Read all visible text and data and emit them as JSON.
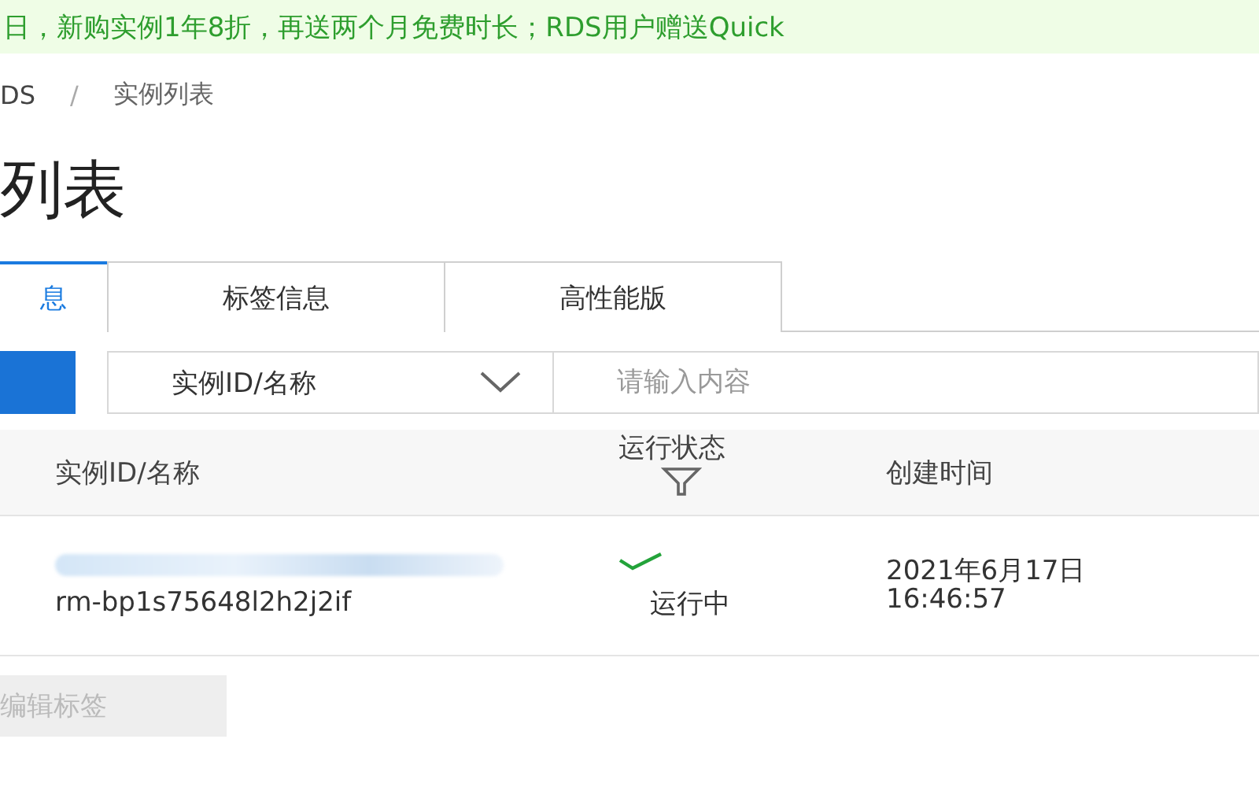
{
  "banner": {
    "text": "日，新购实例1年8折，再送两个月免费时长；RDS用户赠送Quick"
  },
  "breadcrumb": {
    "items": [
      "DS",
      "实例列表"
    ],
    "separator": "/"
  },
  "page_title": "列表",
  "tabs": [
    {
      "label": "息",
      "selected": true
    },
    {
      "label": "标签信息",
      "selected": false
    },
    {
      "label": "高性能版",
      "selected": false
    }
  ],
  "search": {
    "select": "实例ID/名称",
    "placeholder": "请输入内容"
  },
  "table": {
    "columns": [
      "实例ID/名称",
      "运行状态",
      "创建时间"
    ],
    "rows": [
      {
        "id": "rm-bp1s75648l2h2j2if",
        "status": "运行中",
        "running": true,
        "created": "2021年6月17日\n16:46:57"
      }
    ]
  },
  "edit_button": {
    "label": "编辑标签",
    "disabled": true
  }
}
